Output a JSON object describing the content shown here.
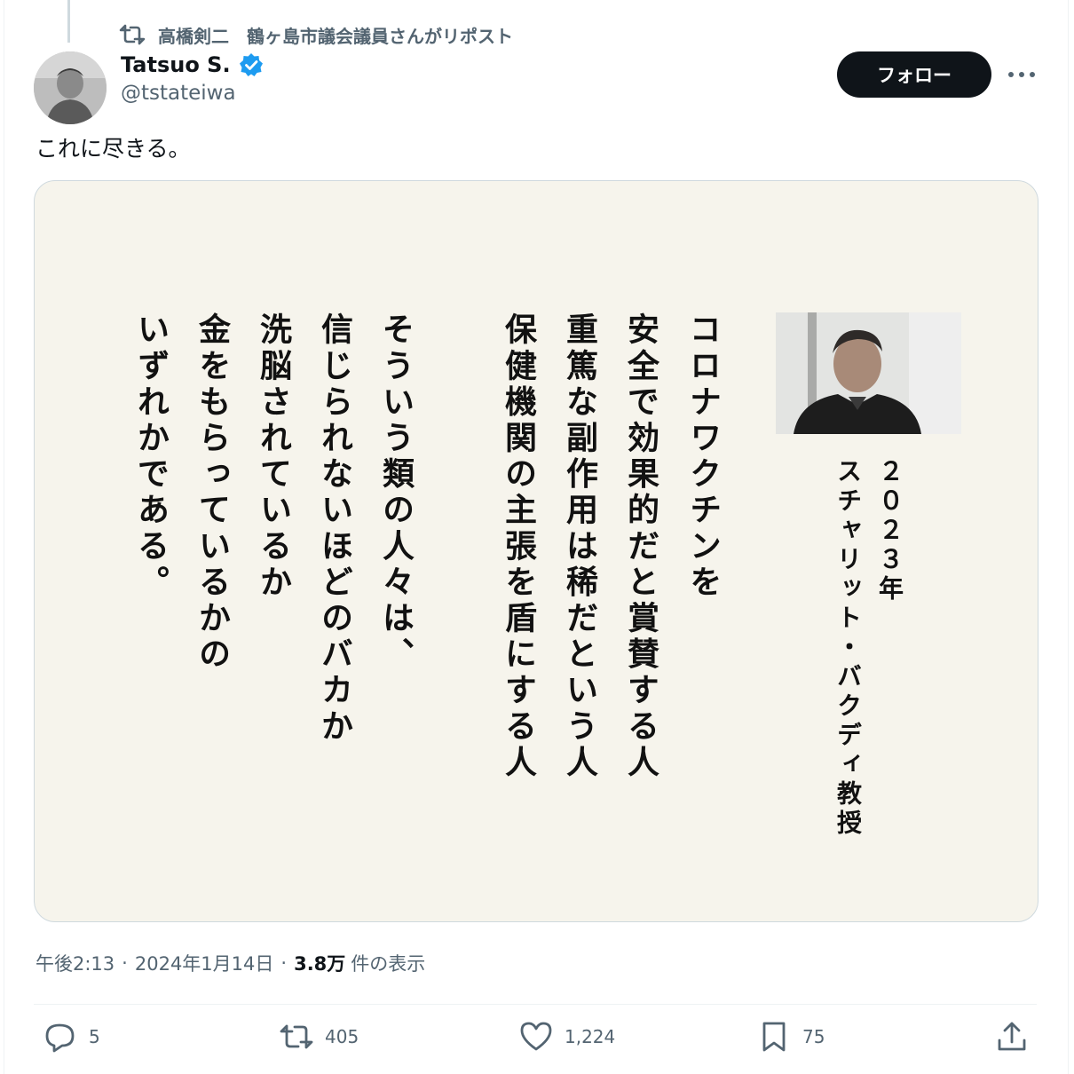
{
  "repost": {
    "text": "高橋剣二　鶴ヶ島市議会議員さんがリポスト",
    "icon": "repost-icon"
  },
  "author": {
    "display_name": "Tatsuo S.",
    "handle": "@tstateiwa",
    "verified_icon": "verified-badge-icon"
  },
  "follow_label": "フォロー",
  "more_icon": "more-horizontal-icon",
  "tweet_text": "これに尽きる。",
  "image": {
    "caption_year": "２０２３年",
    "caption_name": "スチャリット・バクディ教授",
    "lines": [
      "コロナワクチンを",
      "安全で効果的だと賞賛する人",
      "重篤な副作用は稀だという人",
      "保健機関の主張を盾にする人",
      "そういう類の人々は、",
      "信じられないほどのバカか",
      "洗脳されているか",
      "金をもらっているかの",
      "いずれかである。"
    ]
  },
  "meta": {
    "time": "午後2:13",
    "date": "2024年1月14日",
    "views": "3.8万",
    "views_label": "件の表示"
  },
  "actions": {
    "replies": "5",
    "reposts": "405",
    "likes": "1,224",
    "bookmarks": "75"
  },
  "colors": {
    "accent_blue": "#1d9bf0",
    "secondary_text": "#536471",
    "card_background": "#f6f4ec"
  }
}
